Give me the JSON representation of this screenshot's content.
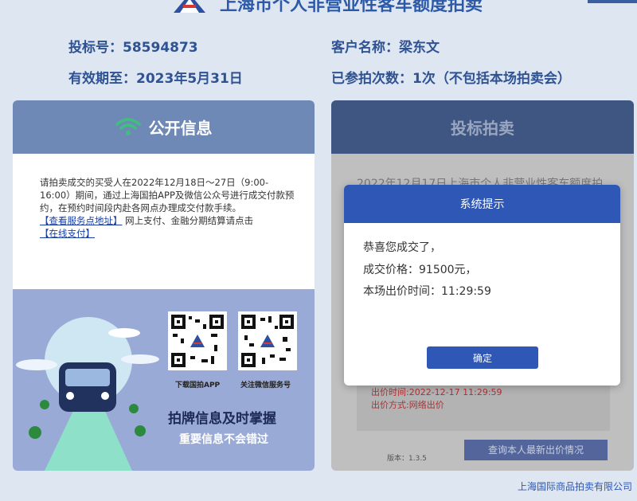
{
  "header": {
    "site_title": "上海市个人非营业性客车额度拍卖",
    "bid_number": "投标号：58594873",
    "customer_name": "客户名称：梁东文",
    "valid_until": "有效期至：2023年5月31日",
    "auction_count": "已参拍次数：1次（不包括本场拍卖会）"
  },
  "left_panel": {
    "title": "公开信息",
    "notice_text": "请拍卖成交的买受人在2022年12月18日～27日（9:00-16:00）期间，通过上海国拍APP及微信公众号进行成交付款预约，在预约时间段内赴各网点办理成交付款手续。",
    "service_link": "【查看服务点地址】",
    "online_text": "网上支付、金融分期结算请点击",
    "pay_link": "【在线支付】",
    "qr1_caption": "下载国拍APP",
    "qr2_caption": "关注微信服务号",
    "slogan_main": "拍牌信息及时掌握",
    "slogan_sub": "重要信息不会错过"
  },
  "right_panel": {
    "title": "投标拍卖",
    "background_text": "2022年12月17日上海市个人非营业性客车额度拍",
    "bid_time": "出价时间:2022-12-17 11:29:59",
    "bid_method": "出价方式:网络出价",
    "version": "版本：1.3.5",
    "query_button": "查询本人最新出价情况"
  },
  "modal": {
    "title": "系统提示",
    "line1": "恭喜您成交了，",
    "line2": "成交价格：91500元，",
    "line3": "本场出价时间：11:29:59",
    "ok_button": "确定"
  },
  "footer": {
    "company": "上海国际商品拍卖有限公司"
  },
  "colors": {
    "primary": "#2e57b6",
    "header_text": "#2f5293",
    "page_bg": "#dde6f1",
    "left_header": "#6f89b6",
    "right_header": "#3f5683",
    "wifi_green": "#3fbf7f"
  }
}
